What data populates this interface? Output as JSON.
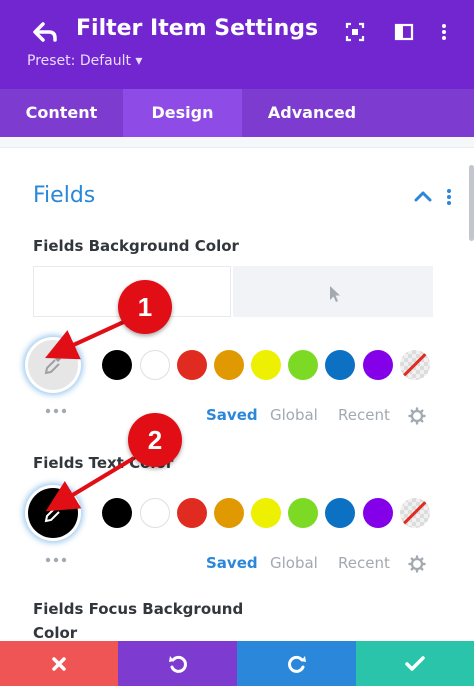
{
  "header": {
    "title": "Filter Item Settings",
    "preset": "Preset: Default ▾",
    "icons": [
      "back-arrow-icon",
      "focus-frame-icon",
      "split-view-icon",
      "vertical-dots-icon"
    ],
    "bg_color": "#7226d0"
  },
  "tabs": [
    {
      "label": "Content",
      "active": false
    },
    {
      "label": "Design",
      "active": true
    },
    {
      "label": "Advanced",
      "active": false
    }
  ],
  "section": {
    "title": "Fields",
    "accent_color": "#2b87da"
  },
  "fields": [
    {
      "label": "Fields Background Color",
      "selected_color": "#e6e6e6",
      "palette_tabs": [
        "Saved",
        "Global",
        "Recent"
      ]
    },
    {
      "label": "Fields Text Color",
      "selected_color": "#000000",
      "palette_tabs": [
        "Saved",
        "Global",
        "Recent"
      ]
    },
    {
      "label_line1": "Fields Focus Background",
      "label_line2": "Color"
    }
  ],
  "swatches": [
    "#000000",
    "#ffffff",
    "#e02b20",
    "#e09900",
    "#edf000",
    "#7cda24",
    "#0c71c3",
    "#8300e9"
  ],
  "annotations": [
    {
      "number": "1"
    },
    {
      "number": "2"
    }
  ],
  "footer": {
    "buttons": [
      {
        "name": "cancel",
        "icon": "close-icon",
        "color": "#ef5555"
      },
      {
        "name": "undo",
        "icon": "undo-icon",
        "color": "#7e3bd0"
      },
      {
        "name": "redo",
        "icon": "redo-icon",
        "color": "#2b87da"
      },
      {
        "name": "save",
        "icon": "check-icon",
        "color": "#29c4a9"
      }
    ]
  }
}
